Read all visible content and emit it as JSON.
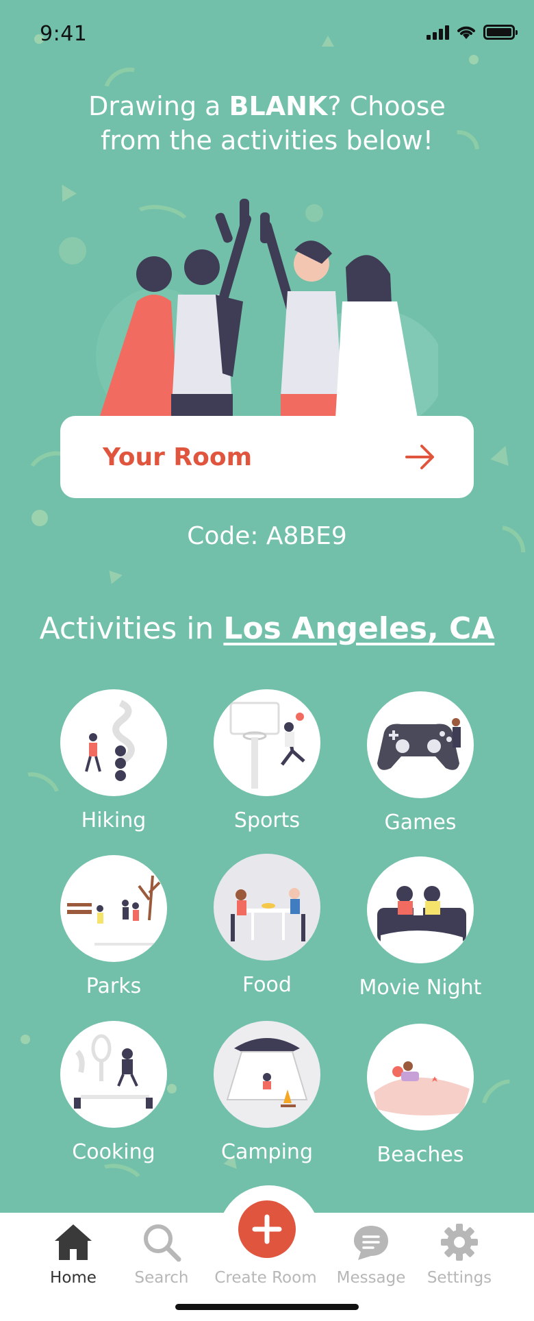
{
  "status_bar": {
    "time": "9:41"
  },
  "header": {
    "line1_prefix": "Drawing a ",
    "line1_bold": "BLANK",
    "line1_suffix": "? Choose",
    "line2": "from the activities below!"
  },
  "room": {
    "label": "Your Room",
    "code": "Code: A8BE9"
  },
  "activities": {
    "title_prefix": "Activities in ",
    "location": "Los Angeles, CA",
    "items": [
      {
        "label": "Hiking",
        "icon": "hiking-icon"
      },
      {
        "label": "Sports",
        "icon": "basketball-icon"
      },
      {
        "label": "Games",
        "icon": "gamepad-icon"
      },
      {
        "label": "Parks",
        "icon": "park-icon"
      },
      {
        "label": "Food",
        "icon": "dining-icon"
      },
      {
        "label": "Movie Night",
        "icon": "movie-night-icon"
      },
      {
        "label": "Cooking",
        "icon": "cooking-icon"
      },
      {
        "label": "Camping",
        "icon": "tent-icon"
      },
      {
        "label": "Beaches",
        "icon": "beach-icon"
      }
    ]
  },
  "nav": {
    "items": [
      {
        "label": "Home",
        "icon": "home-icon",
        "active": true
      },
      {
        "label": "Search",
        "icon": "search-icon",
        "active": false
      },
      {
        "label": "Create Room",
        "icon": "plus-icon",
        "active": false
      },
      {
        "label": "Message",
        "icon": "message-icon",
        "active": false
      },
      {
        "label": "Settings",
        "icon": "gear-icon",
        "active": false
      }
    ]
  },
  "colors": {
    "background": "#72c0a9",
    "accent": "#e0553d",
    "card": "#ffffff",
    "nav_inactive": "#b7b7b7",
    "nav_active": "#333333"
  }
}
